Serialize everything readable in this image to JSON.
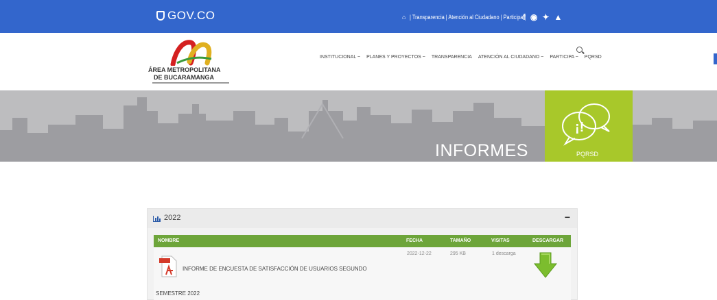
{
  "topbar": {
    "logo_text": "GOV.CO",
    "links": "| Transparencia | Atención al Ciudadano | Participa |",
    "social_icons": [
      "home-icon",
      "facebook-icon",
      "instagram-icon",
      "twitter-icon",
      "youtube-icon"
    ],
    "bg_color": "#3366cc"
  },
  "header": {
    "logo_line1": "ÁREA METROPOLITANA",
    "logo_line2": "DE BUCARAMANGA",
    "nav": [
      "INSTITUCIONAL ~",
      "PLANES Y PROYECTOS ~",
      "TRANSPARENCIA",
      "ATENCIÓN AL CIUDADANO ~",
      "PARTICIPA ~",
      "PQRSD"
    ]
  },
  "banner": {
    "title": "INFORMES",
    "pqrsd_label": "PQRSD",
    "accent": "#a8c82a"
  },
  "panel": {
    "year": "2022",
    "collapse_symbol": "−",
    "columns": [
      "NOMBRE",
      "FECHA",
      "TAMAÑO",
      "VISITAS",
      "DESCARGAR"
    ],
    "header_color": "#6da53a",
    "rows": [
      {
        "title_part1": "INFORME DE ENCUESTA DE SATISFACCIÓN DE USUARIOS SEGUNDO",
        "title_part2": "SEMESTRE 2022",
        "fecha": "2022-12-22",
        "tamano": "295 KB",
        "visitas": "1 descarga"
      }
    ]
  }
}
